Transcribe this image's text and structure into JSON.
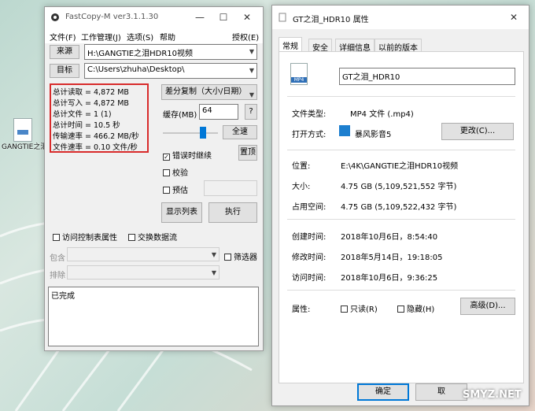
{
  "desktop": {
    "icon_label": "GANGTIE之泪HDR10..."
  },
  "fastcopy": {
    "title": "FastCopy-M ver3.1.1.30",
    "menu": [
      "文件(F)",
      "工作管理(J)",
      "选项(S)",
      "帮助"
    ],
    "menu_right": "授权(E)",
    "source_button": "来源",
    "source_path": "H:\\GANGTIE之泪HDR10视频",
    "dest_button": "目标",
    "dest_path": "C:\\Users\\zhuha\\Desktop\\",
    "stats": [
      "总计读取 = 4,872 MB",
      "总计写入 = 4,872 MB",
      "总计文件 = 1 (1)",
      "总计时间 = 10.5 秒",
      "传输速率 = 466.2 MB/秒",
      "文件速率 = 0.10 文件/秒"
    ],
    "mode_select": "差分复制（大小/日期）",
    "buffer_label": "缓存(MB)",
    "buffer_value": "64",
    "help_button": "?",
    "speed_button": "全速",
    "speed_level": 0.75,
    "continue_on_error": "错误时继续",
    "verify": "校验",
    "estimate": "预估",
    "top_button": "置顶",
    "list_button": "显示列表",
    "execute_button": "执行",
    "acl": "访问控制表属性",
    "alt_stream": "交换数据流",
    "include_label": "包含",
    "exclude_label": "排除",
    "filter": "筛选器",
    "status_text": "已完成"
  },
  "props": {
    "title": "GT之泪_HDR10 属性",
    "tabs": [
      "常规",
      "安全",
      "详细信息",
      "以前的版本"
    ],
    "file_icon_text": "MP4",
    "file_name": "GT之泪_HDR10",
    "type_label": "文件类型:",
    "type_value": "MP4 文件 (.mp4)",
    "open_label": "打开方式:",
    "open_value": "暴风影音5",
    "change_button": "更改(C)...",
    "location_label": "位置:",
    "location_value": "E:\\4K\\GANGTIE之泪HDR10视频",
    "size_label": "大小:",
    "size_value": "4.75 GB (5,109,521,552 字节)",
    "disk_label": "占用空间:",
    "disk_value": "4.75 GB (5,109,522,432 字节)",
    "created_label": "创建时间:",
    "created_value": "2018年10月6日，8:54:40",
    "modified_label": "修改时间:",
    "modified_value": "2018年5月14日，19:18:05",
    "accessed_label": "访问时间:",
    "accessed_value": "2018年10月6日，9:36:25",
    "attr_label": "属性:",
    "readonly": "只读(R)",
    "hidden": "隐藏(H)",
    "advanced_button": "高级(D)...",
    "ok_button": "确定",
    "cancel_button": "取"
  },
  "watermark": "SMYZ.NET"
}
